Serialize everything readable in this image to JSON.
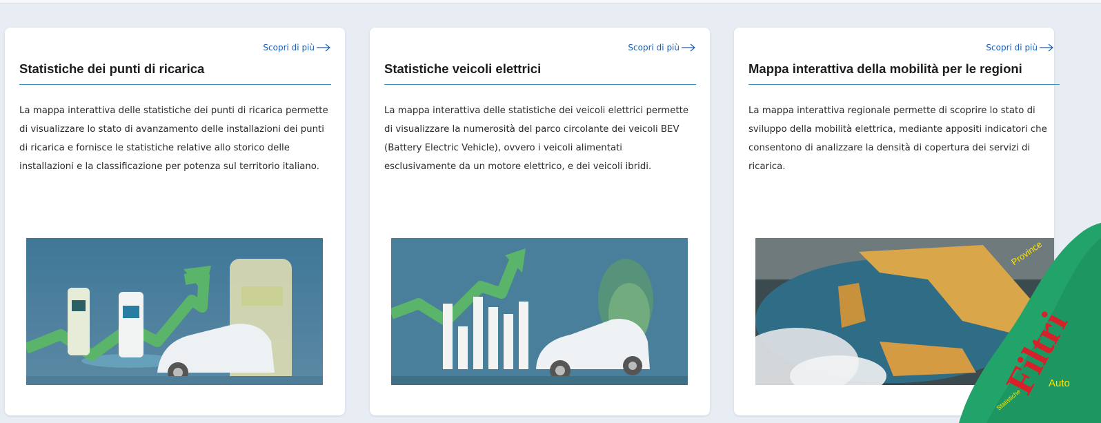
{
  "cards": [
    {
      "link_label": "Scopri di più",
      "title": "Statistiche dei punti di ricarica",
      "description": "La mappa interattiva delle statistiche dei punti di ricarica permette di visualizzare lo stato di avanzamento delle installazioni dei punti di ricarica e fornisce le statistiche relative allo storico delle installazioni e la classificazione per potenza sul territorio italiano.",
      "image_icon": "charging-stations-illustration"
    },
    {
      "link_label": "Scopri di più",
      "title": "Statistiche veicoli elettrici",
      "description": "La mappa interattiva delle statistiche dei veicoli elettrici permette di visualizzare la numerosità del parco circolante dei veicoli BEV (Battery Electric Vehicle), ovvero i veicoli alimentati esclusivamente da un motore elettrico, e dei veicoli ibridi.",
      "image_icon": "electric-vehicles-illustration"
    },
    {
      "link_label": "Scopri di più",
      "title": "Mappa interattiva della mobilità per le regioni",
      "description": "La mappa interattiva regionale permette di scoprire lo stato di sviluppo della mobilità elettrica, mediante appositi indicatori che consentono di analizzare la densità di copertura dei servizi di ricarica.",
      "image_icon": "italy-3d-map-illustration"
    }
  ],
  "overlay": {
    "main_text": "Filtri",
    "tags": [
      "Province",
      "Auto",
      "Statistiche"
    ]
  },
  "colors": {
    "background": "#e8edf4",
    "link": "#1a5db1",
    "divider": "#3b90b3",
    "overlay_green": "#22a36a",
    "overlay_red": "#d6202a"
  }
}
